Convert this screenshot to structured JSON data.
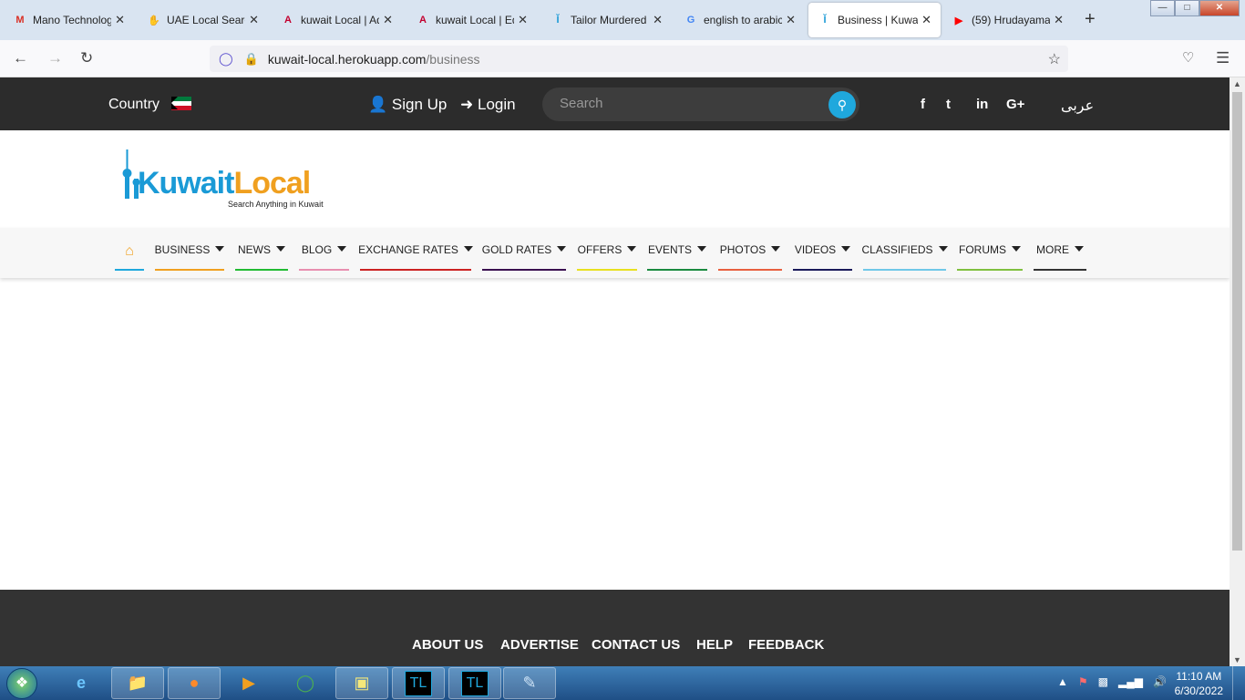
{
  "browser": {
    "tabs": [
      {
        "title": "Mano Technolog",
        "icon": "gmail-icon",
        "favtext": "M",
        "favcolor": "#d93025"
      },
      {
        "title": "UAE Local Search",
        "icon": "hand-icon",
        "favtext": "✋",
        "favcolor": "#000000"
      },
      {
        "title": "kuwait Local | Ad",
        "icon": "angular-icon",
        "favtext": "A",
        "favcolor": "#c3002f"
      },
      {
        "title": "kuwait Local | Edi",
        "icon": "angular-icon",
        "favtext": "A",
        "favcolor": "#c3002f"
      },
      {
        "title": "Tailor Murdered I",
        "icon": "tower-icon",
        "favtext": "Ĭ",
        "favcolor": "#1a9ad6"
      },
      {
        "title": "english to arabic",
        "icon": "google-icon",
        "favtext": "G",
        "favcolor": "#4285f4"
      },
      {
        "title": "Business | Kuwait",
        "icon": "tower-icon",
        "favtext": "Ĭ",
        "favcolor": "#1a9ad6"
      },
      {
        "title": "(59) Hrudayama",
        "icon": "youtube-icon",
        "favtext": "▶",
        "favcolor": "#ff0000"
      }
    ],
    "url_host": "kuwait-local.herokuapp.com",
    "url_path": "/business"
  },
  "header": {
    "country_label": "Country",
    "signup_label": "Sign Up",
    "login_label": "Login",
    "search_placeholder": "Search",
    "arabic_label": "عربى",
    "social": [
      {
        "name": "facebook-icon",
        "glyph": "f"
      },
      {
        "name": "twitter-icon",
        "glyph": "t"
      },
      {
        "name": "linkedin-icon",
        "glyph": "in"
      },
      {
        "name": "google-plus-icon",
        "glyph": "G+"
      }
    ]
  },
  "logo": {
    "word1": "Kuwait",
    "word2": "Local",
    "tagline": "Search Anything in Kuwait"
  },
  "menu": {
    "items": [
      {
        "label": "BUSINESS",
        "color": "#f0a020"
      },
      {
        "label": "NEWS",
        "color": "#22bb33"
      },
      {
        "label": "BLOG",
        "color": "#e88fb0"
      },
      {
        "label": "EXCHANGE RATES",
        "color": "#cc2222"
      },
      {
        "label": "GOLD RATES",
        "color": "#3a1050"
      },
      {
        "label": "OFFERS",
        "color": "#e8e020"
      },
      {
        "label": "EVENTS",
        "color": "#1a8a40"
      },
      {
        "label": "PHOTOS",
        "color": "#e86040"
      },
      {
        "label": "VIDEOS",
        "color": "#1a1a5a"
      },
      {
        "label": "CLASSIFIEDS",
        "color": "#70c8e8"
      },
      {
        "label": "FORUMS",
        "color": "#80c040"
      },
      {
        "label": "MORE",
        "color": "#333333"
      }
    ],
    "home_color": "#1fa8dd"
  },
  "footer": {
    "links": [
      "ABOUT US",
      "ADVERTISE",
      "CONTACT US",
      "HELP",
      "FEEDBACK"
    ]
  },
  "taskbar": {
    "time": "11:10 AM",
    "date": "6/30/2022"
  }
}
